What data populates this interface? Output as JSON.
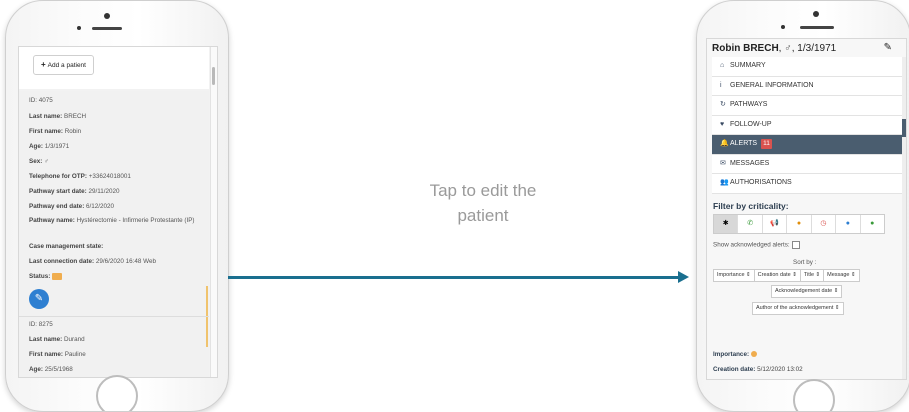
{
  "left_screen": {
    "add_button_label": "Add a patient",
    "patients": [
      {
        "id": "ID: 4075",
        "last_name_label": "Last name:",
        "last_name": "BRECH",
        "first_name_label": "First name:",
        "first_name": "Robin",
        "age_label": "Age:",
        "age": "1/3/1971",
        "sex_label": "Sex:",
        "sex": "♂",
        "otp_label": "Telephone for OTP:",
        "otp": "+33624018001",
        "start_label": "Pathway start date:",
        "start": "29/11/2020",
        "end_label": "Pathway end date:",
        "end": "6/12/2020",
        "pathway_label": "Pathway name:",
        "pathway": "Hystérectomie - Infirmerie Protestante (IP)",
        "case_label": "Case management state:",
        "last_conn_label": "Last connection date:",
        "last_conn": "29/6/2020 16:48",
        "last_conn_src": "Web",
        "status_label": "Status:"
      },
      {
        "id": "ID: 8275",
        "last_name_label": "Last name:",
        "last_name": "Durand",
        "first_name_label": "First name:",
        "first_name": "Pauline",
        "age_label": "Age:",
        "age": "25/5/1968"
      }
    ]
  },
  "middle": {
    "caption_line1": "Tap to edit the",
    "caption_line2": "patient"
  },
  "right_screen": {
    "patient_name": "Robin BRECH",
    "patient_sex": "♂",
    "patient_dob": "1/3/1971",
    "menu": [
      {
        "icon": "home-icon",
        "glyph": "⌂",
        "label": "SUMMARY"
      },
      {
        "icon": "info-icon",
        "glyph": "i",
        "label": "GENERAL INFORMATION"
      },
      {
        "icon": "pathways-icon",
        "glyph": "↻",
        "label": "PATHWAYS"
      },
      {
        "icon": "follow-up-icon",
        "glyph": "♥",
        "label": "FOLLOW-UP"
      },
      {
        "icon": "bell-icon",
        "glyph": "🔔",
        "label": "ALERTS",
        "badge": "11"
      },
      {
        "icon": "messages-icon",
        "glyph": "✉",
        "label": "MESSAGES"
      },
      {
        "icon": "users-icon",
        "glyph": "👥",
        "label": "AUTHORISATIONS"
      }
    ],
    "filter_title": "Filter by criticality:",
    "show_ack_label": "Show acknowledged alerts:",
    "sort_by_label": "Sort by :",
    "sort_row1": [
      "Importance ⇕",
      "Creation date ⇕",
      "Title ⇕",
      "Message ⇕"
    ],
    "sort_row2": [
      "Acknowledgement date ⇕"
    ],
    "sort_row3": [
      "Author of the acknowledgement ⇕"
    ],
    "importance_label": "Importance:",
    "creation_label": "Creation date:",
    "creation_value": "5/12/2020 13:02",
    "colors": {
      "accent": "#1a6f8f",
      "active_menu": "#4a5d6f",
      "badge": "#d9534f",
      "edit": "#2e7fd1",
      "warning": "#f0ad4e"
    }
  }
}
